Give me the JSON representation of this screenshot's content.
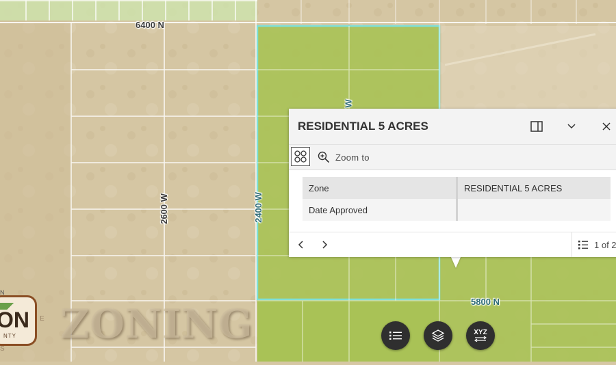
{
  "map": {
    "road_labels": {
      "n6400": "6400 N",
      "n5800": "5800 N",
      "w2600": "2600 W",
      "w2400": "2400 W",
      "w_partial": "W"
    },
    "overlay_title": "ZONING",
    "logo": {
      "text": "ON",
      "subtext": "NTY",
      "edge_n": "N",
      "edge_e": "E",
      "edge_s": "S"
    },
    "colors": {
      "terrain": "#d6c7a4",
      "residential_zone": "#a9c255",
      "parcel_outline": "#ffffff",
      "zone_border": "#7fe0d8"
    }
  },
  "popup": {
    "title": "RESIDENTIAL 5 ACRES",
    "toolbar": {
      "zoom_label": "Zoom to"
    },
    "attributes": [
      {
        "key": "Zone",
        "value": "RESIDENTIAL 5 ACRES"
      },
      {
        "key": "Date Approved",
        "value": ""
      }
    ],
    "footer": {
      "counter": "1 of 2"
    },
    "icons": {
      "dock": "dock-icon",
      "collapse": "chevron-down-icon",
      "close": "close-icon",
      "features": "features-grid-icon",
      "zoom": "zoom-in-icon",
      "prev": "chevron-left-icon",
      "next": "chevron-right-icon",
      "list": "list-icon"
    }
  },
  "widgets": {
    "legend_icon": "list-icon",
    "layers_icon": "layers-icon",
    "coordinate_label": "XYZ"
  }
}
